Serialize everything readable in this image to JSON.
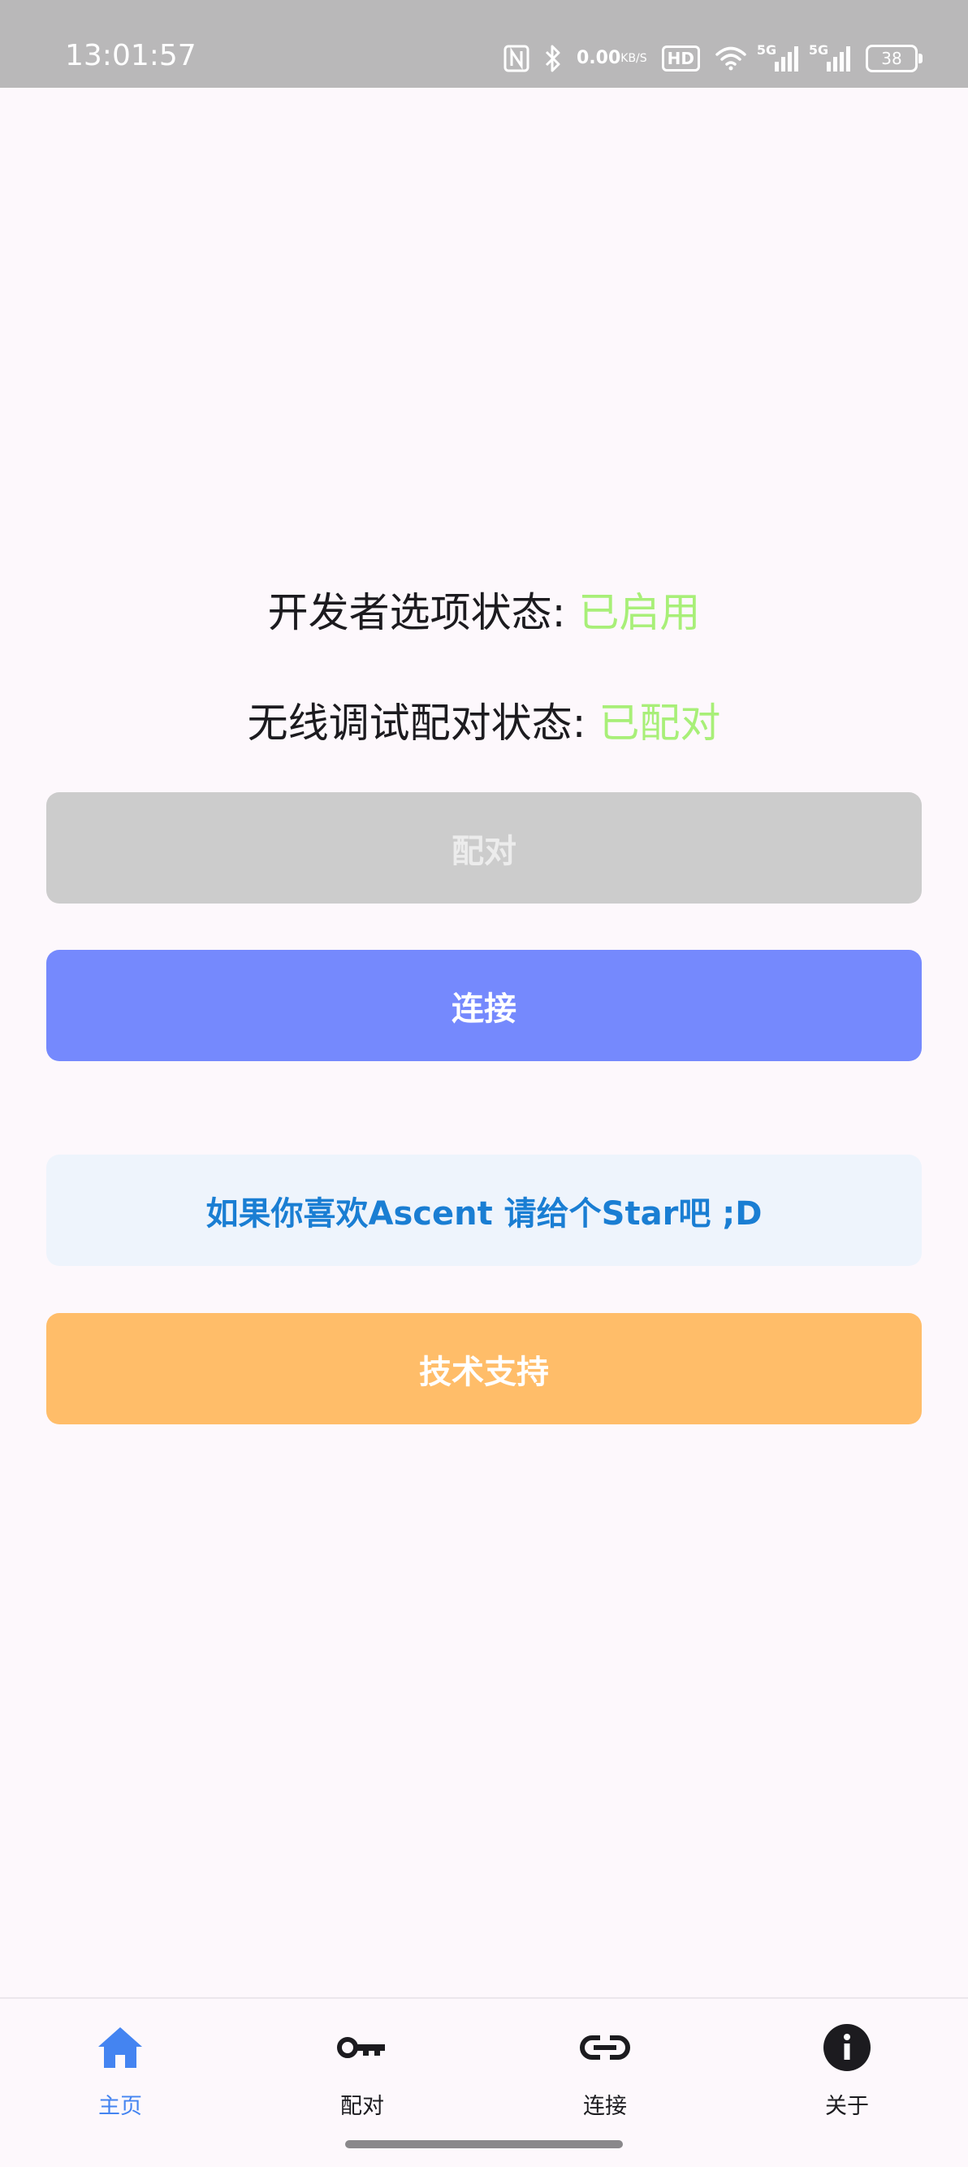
{
  "status_bar": {
    "time": "13:01:57",
    "net_speed_value": "0.00",
    "net_speed_unit": "KB/S",
    "hd_badge": "HD",
    "signal_1_label": "5G",
    "signal_2_label": "5G",
    "battery": "38"
  },
  "main": {
    "developer_options_label": "开发者选项状态: ",
    "developer_options_value": "已启用",
    "wireless_pairing_label": "无线调试配对状态: ",
    "wireless_pairing_value": "已配对",
    "pair_button": "配对",
    "connect_button": "连接",
    "star_button": "如果你喜欢Ascent 请给个Star吧 ;D",
    "support_button": "技术支持"
  },
  "bottom_nav": {
    "items": [
      {
        "label": "主页",
        "icon": "home-icon",
        "active": true
      },
      {
        "label": "配对",
        "icon": "key-icon",
        "active": false
      },
      {
        "label": "连接",
        "icon": "link-icon",
        "active": false
      },
      {
        "label": "关于",
        "icon": "info-icon",
        "active": false
      }
    ]
  },
  "colors": {
    "status_value": "#a8ef78",
    "connect": "#7589fd",
    "star_text": "#1a7ed3",
    "support": "#ffbd69",
    "nav_active": "#4484f1"
  }
}
